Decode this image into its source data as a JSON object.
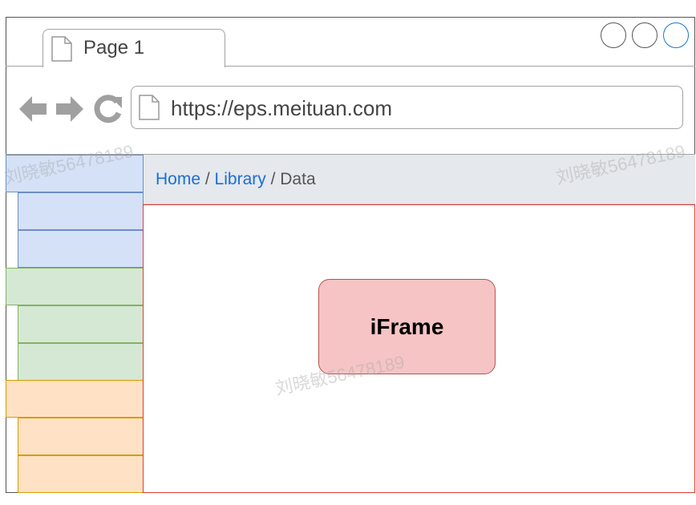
{
  "browser": {
    "tab_title": "Page 1",
    "url": "https://eps.meituan.com",
    "window_buttons": [
      "circle-gray",
      "circle-gray",
      "circle-blue"
    ],
    "nav_icons": [
      "back-arrow-icon",
      "forward-arrow-icon",
      "refresh-icon"
    ]
  },
  "breadcrumb": {
    "items": [
      "Home",
      "Library",
      "Data"
    ],
    "separator": "/"
  },
  "sidebar": {
    "groups": [
      {
        "color": "#d4e1f7",
        "border": "#6c8ebf",
        "items": 3
      },
      {
        "color": "#d5e8d4",
        "border": "#82b366",
        "items": 3
      },
      {
        "color": "#ffe2c5",
        "border": "#d79b00",
        "items": 3
      }
    ]
  },
  "content": {
    "iframe_label": "iFrame",
    "border_color": "#e53935"
  },
  "watermark": "刘晓敏56478189",
  "colors": {
    "link": "#1a6ed8",
    "breadcrumb_bg": "#e5e8ec",
    "iframe_fill": "#f6c4c4",
    "iframe_stroke": "#b85450"
  }
}
